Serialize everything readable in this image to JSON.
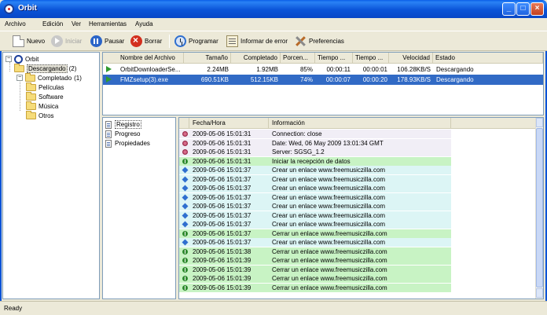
{
  "window": {
    "title": "Orbit"
  },
  "menu": [
    "Archivo",
    "Edición",
    "Ver",
    "Herramientas",
    "Ayuda"
  ],
  "toolbar": {
    "new": "Nuevo",
    "start": "Iniciar",
    "pause": "Pausar",
    "delete": "Borrar",
    "schedule": "Programar",
    "report": "Informar de error",
    "prefs": "Preferencias"
  },
  "tree": {
    "root": "Orbit",
    "downloading": "Descargando",
    "downloading_count": "(2)",
    "completed": "Completado",
    "completed_count": "(1)",
    "sub": [
      "Películas",
      "Software",
      "Música",
      "Otros"
    ]
  },
  "downloads": {
    "columns": [
      "Nombre del Archivo",
      "Tamaño",
      "Completado",
      "Porcen...",
      "Tiempo ...",
      "Tiempo ...",
      "Velocidad",
      "Estado"
    ],
    "rows": [
      {
        "name": "OrbitDownloaderSe...",
        "size": "2.24MB",
        "done": "1.92MB",
        "pct": "85%",
        "t1": "00:00:11",
        "t2": "00:00:01",
        "speed": "106.28KB/S",
        "status": "Descargando"
      },
      {
        "name": "FMZsetup(3).exe",
        "size": "690.51KB",
        "done": "512.15KB",
        "pct": "74%",
        "t1": "00:00:07",
        "t2": "00:00:20",
        "speed": "178.93KB/S",
        "status": "Descargando"
      }
    ]
  },
  "info_tabs": [
    "Registro",
    "Progreso",
    "Propiedades"
  ],
  "log": {
    "columns": [
      "Fecha/Hora",
      "Información"
    ],
    "rows": [
      {
        "icon": "pink",
        "time": "2009-05-06 15:01:31",
        "msg": "Connection: close",
        "bg": "#f1eef6"
      },
      {
        "icon": "pink",
        "time": "2009-05-06 15:01:31",
        "msg": "Date: Wed, 06 May 2009 13:01:34 GMT",
        "bg": "#f1eef6"
      },
      {
        "icon": "pink",
        "time": "2009-05-06 15:01:31",
        "msg": "Server: SGSG_1.2",
        "bg": "#f1eef6"
      },
      {
        "icon": "green",
        "time": "2009-05-06 15:01:31",
        "msg": "Iniciar la recepción de datos",
        "bg": "#c8f3c4"
      },
      {
        "icon": "blue",
        "time": "2009-05-06 15:01:37",
        "msg": "Crear un enlace www.freemusiczilla.com",
        "bg": "#dcf5f5"
      },
      {
        "icon": "blue",
        "time": "2009-05-06 15:01:37",
        "msg": "Crear un enlace www.freemusiczilla.com",
        "bg": "#dcf5f5"
      },
      {
        "icon": "blue",
        "time": "2009-05-06 15:01:37",
        "msg": "Crear un enlace www.freemusiczilla.com",
        "bg": "#dcf5f5"
      },
      {
        "icon": "blue",
        "time": "2009-05-06 15:01:37",
        "msg": "Crear un enlace www.freemusiczilla.com",
        "bg": "#dcf5f5"
      },
      {
        "icon": "blue",
        "time": "2009-05-06 15:01:37",
        "msg": "Crear un enlace www.freemusiczilla.com",
        "bg": "#dcf5f5"
      },
      {
        "icon": "blue",
        "time": "2009-05-06 15:01:37",
        "msg": "Crear un enlace www.freemusiczilla.com",
        "bg": "#dcf5f5"
      },
      {
        "icon": "blue",
        "time": "2009-05-06 15:01:37",
        "msg": "Crear un enlace www.freemusiczilla.com",
        "bg": "#dcf5f5"
      },
      {
        "icon": "green",
        "time": "2009-05-06 15:01:37",
        "msg": "Cerrar un enlace www.freemusiczilla.com",
        "bg": "#c8f3c4"
      },
      {
        "icon": "blue",
        "time": "2009-05-06 15:01:37",
        "msg": "Crear un enlace www.freemusiczilla.com",
        "bg": "#dcf5f5"
      },
      {
        "icon": "green",
        "time": "2009-05-06 15:01:38",
        "msg": "Cerrar un enlace www.freemusiczilla.com",
        "bg": "#c8f3c4"
      },
      {
        "icon": "green",
        "time": "2009-05-06 15:01:39",
        "msg": "Cerrar un enlace www.freemusiczilla.com",
        "bg": "#c8f3c4"
      },
      {
        "icon": "green",
        "time": "2009-05-06 15:01:39",
        "msg": "Cerrar un enlace www.freemusiczilla.com",
        "bg": "#c8f3c4"
      },
      {
        "icon": "green",
        "time": "2009-05-06 15:01:39",
        "msg": "Cerrar un enlace www.freemusiczilla.com",
        "bg": "#c8f3c4"
      },
      {
        "icon": "green",
        "time": "2009-05-06 15:01:39",
        "msg": "Cerrar un enlace www.freemusiczilla.com",
        "bg": "#c8f3c4"
      }
    ]
  },
  "status": "Ready",
  "colors": {
    "title_bar": "#0a54d8",
    "selection": "#316ac5",
    "log_green": "#c8f3c4",
    "log_cyan": "#dcf5f5",
    "log_lavender": "#f1eef6"
  }
}
